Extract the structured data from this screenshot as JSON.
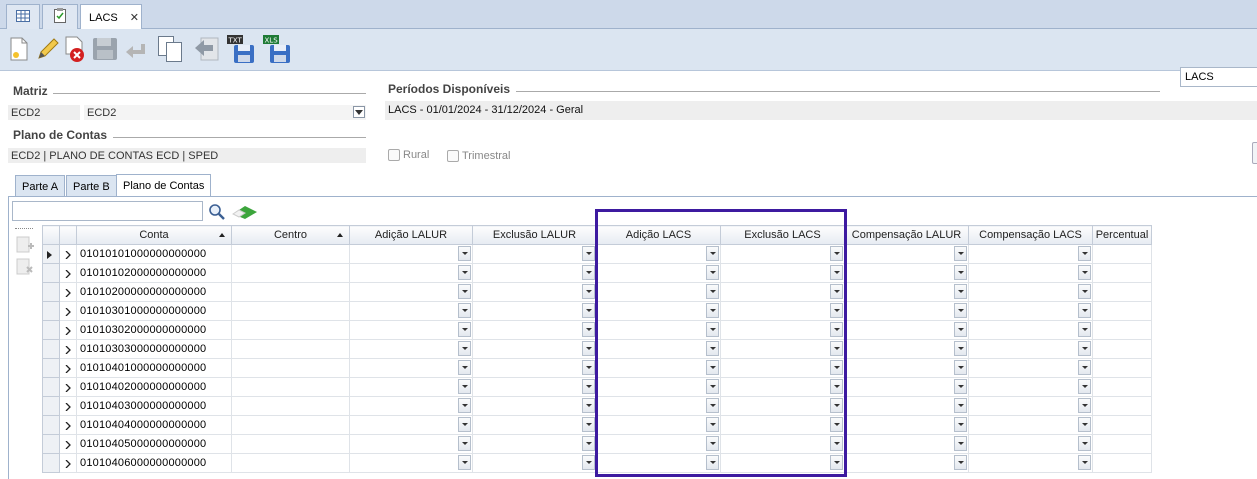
{
  "tabs": {
    "items": [
      {
        "label": "",
        "icon": "grid-icon"
      },
      {
        "label": "",
        "icon": "clipboard-check-icon"
      },
      {
        "label": "LACS",
        "icon": ""
      }
    ],
    "close": "✕"
  },
  "toolbar": {
    "buttons": [
      "new-icon",
      "edit-icon",
      "delete-icon",
      "save-icon",
      "undo-icon",
      "copy-icon",
      "back-icon",
      "export-txt-icon",
      "export-xls-icon"
    ],
    "search_value": "LACS"
  },
  "matriz": {
    "title": "Matriz",
    "code": "ECD2",
    "name": "ECD2"
  },
  "periodos": {
    "title": "Períodos Disponíveis",
    "selected": "LACS - 01/01/2024 - 31/12/2024 - Geral"
  },
  "plano": {
    "title": "Plano de Contas",
    "value": "ECD2 | PLANO DE CONTAS ECD | SPED"
  },
  "options": {
    "rural": "Rural",
    "trimestral": "Trimestral"
  },
  "subtabs": [
    "Parte A",
    "Parte B",
    "Plano de Contas"
  ],
  "grid": {
    "search_value": "",
    "columns": [
      "Conta",
      "Centro",
      "Adição LALUR",
      "Exclusão LALUR",
      "Adição LACS",
      "Exclusão LACS",
      "Compensação LALUR",
      "Compensação LACS",
      "Percentual"
    ],
    "rows": [
      "01010101000000000000",
      "01010102000000000000",
      "01010200000000000000",
      "01010301000000000000",
      "01010302000000000000",
      "01010303000000000000",
      "01010401000000000000",
      "01010402000000000000",
      "01010403000000000000",
      "01010404000000000000",
      "01010405000000000000",
      "01010406000000000000"
    ]
  },
  "colors": {
    "highlight": "#3d1aa0"
  }
}
